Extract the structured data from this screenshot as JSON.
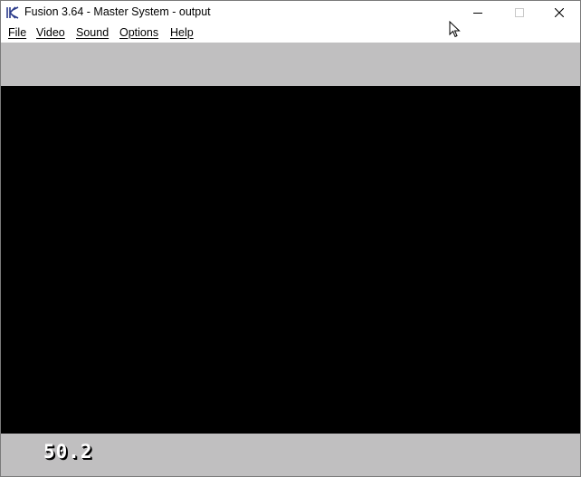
{
  "window": {
    "title": "Fusion 3.64 - Master System - output"
  },
  "title_icons": {
    "app": "fusion-app-icon",
    "minimize": "minimize-icon",
    "maximize": "maximize-icon",
    "close": "close-icon"
  },
  "menu": {
    "items": [
      {
        "label": "File"
      },
      {
        "label": "Video"
      },
      {
        "label": "Sound"
      },
      {
        "label": "Options"
      },
      {
        "label": "Help"
      }
    ]
  },
  "overlay": {
    "fps_value": "50.2"
  },
  "colors": {
    "border_gray": "#c0bfc0",
    "screen_black": "#000000",
    "fps_text": "#ffffff"
  }
}
